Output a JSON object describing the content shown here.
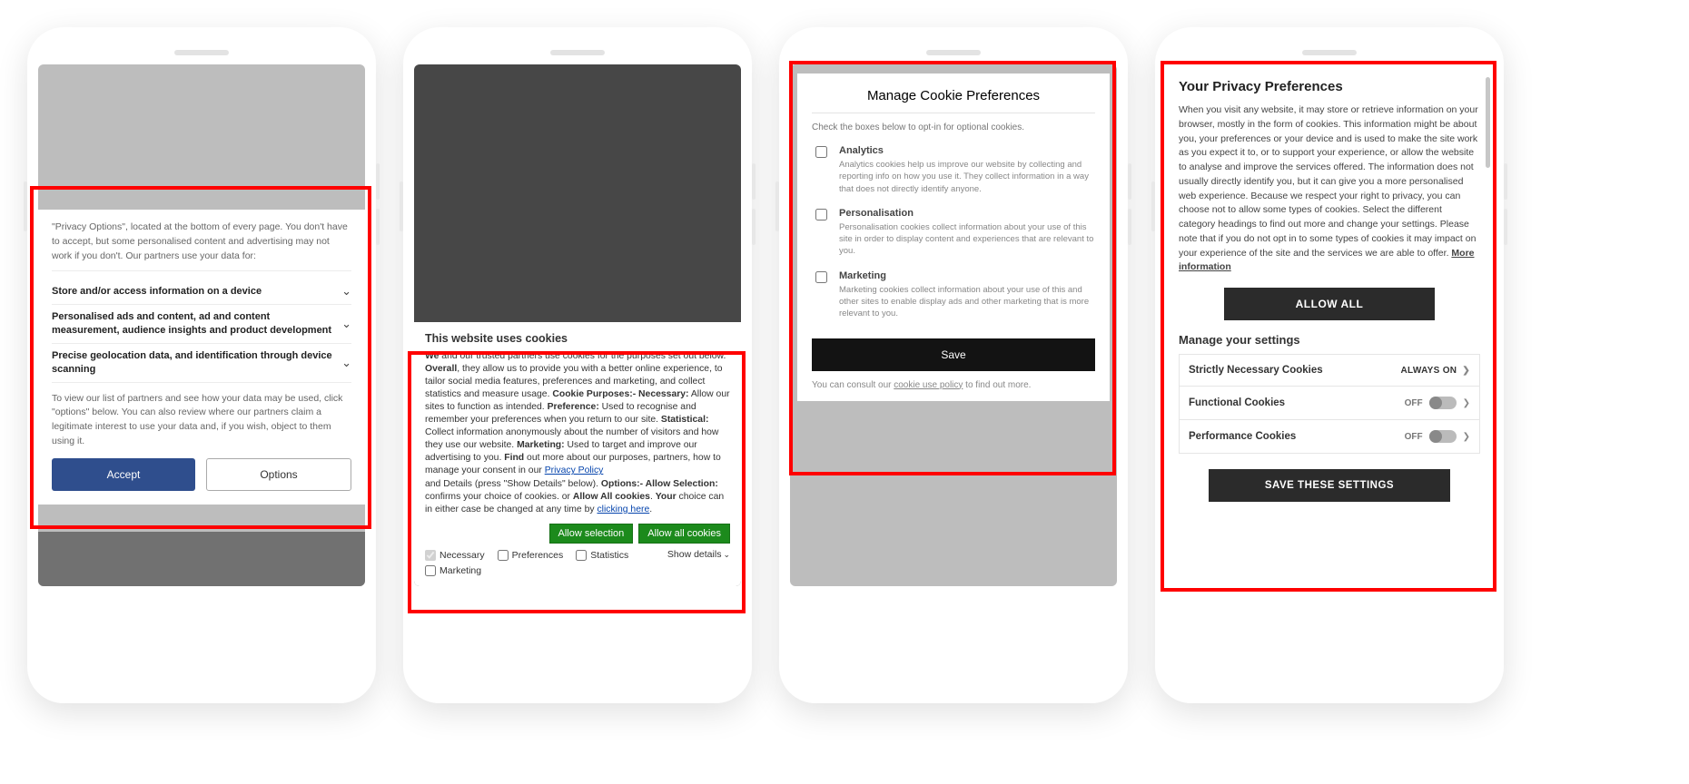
{
  "phone1": {
    "intro": "\"Privacy Options\", located at the bottom of every page. You don't have to accept, but some personalised content and advertising may not work if you don't. Our partners use your data for:",
    "rows": [
      "Store and/or access information on a device",
      "Personalised ads and content, ad and content measurement, audience insights and product development",
      "Precise geolocation data, and identification through device scanning"
    ],
    "outro": "To view our list of partners and see how your data may be used, click \"options\" below. You can also review where our partners claim a legitimate interest to use your data and, if you wish, object to them using it.",
    "accept": "Accept",
    "options": "Options"
  },
  "phone2": {
    "title": "This website uses cookies",
    "t": {
      "we": "We",
      "t1": " and our trusted partners use cookies for the purposes set out below. ",
      "overall": "Overall",
      "t2": ", they allow us to provide you with a better online experience, to tailor social media features, preferences and marketing, and collect statistics and measure usage. ",
      "cp": "Cookie Purposes:- Necessary:",
      "t3": " Allow our sites to function as intended. ",
      "pref": "Preference:",
      "t4": " Used to recognise and remember your preferences when you return to our site. ",
      "stat": "Statistical:",
      "t5": " Collect information anonymously about the number of visitors and how they use our website. ",
      "mkt": "Marketing:",
      "t6": " Used to target and improve our advertising to you. ",
      "find": "Find",
      "t7": " out more about our purposes, partners, how to manage your consent in our ",
      "pp": "Privacy Policy",
      "t8": " and Details (press \"Show Details\" below). ",
      "opt": "Options:- Allow Selection:",
      "t9": " confirms your choice of cookies. or ",
      "aac": "Allow All cookies",
      "t10": ". ",
      "your": "Your",
      "t11": " choice can in either case be changed at any time by ",
      "click": "clicking here",
      "t12": "."
    },
    "btn_sel": "Allow selection",
    "btn_all": "Allow all cookies",
    "chk": {
      "nec": "Necessary",
      "pref": "Preferences",
      "stat": "Statistics",
      "mkt": "Marketing"
    },
    "show": "Show details"
  },
  "phone3": {
    "title": "Manage Cookie Preferences",
    "sub": "Check the boxes below to opt-in for optional cookies.",
    "opts": [
      {
        "t": "Analytics",
        "d": "Analytics cookies help us improve our website by collecting and reporting info on how you use it. They collect information in a way that does not directly identify anyone."
      },
      {
        "t": "Personalisation",
        "d": "Personalisation cookies collect information about your use of this site in order to display content and experiences that are relevant to you."
      },
      {
        "t": "Marketing",
        "d": "Marketing cookies collect information about your use of this and other sites to enable display ads and other marketing that is more relevant to you."
      }
    ],
    "save": "Save",
    "pol_a": "You can consult our ",
    "pol_b": "cookie use policy",
    "pol_c": " to find out more."
  },
  "phone4": {
    "title": "Your Privacy Preferences",
    "body": "When you visit any website, it may store or retrieve information on your browser, mostly in the form of cookies. This information might be about you, your preferences or your device and is used to make the site work as you expect it to, or to support your experience, or allow the website to analyse and improve the services offered. The information does not usually directly identify you, but it can give you a more personalised web experience. Because we respect your right to privacy, you can choose not to allow some types of cookies. Select the different category headings to find out more and change your settings. Please note that if you do not opt in to some types of cookies it may impact on your experience of the site and the services we are able to offer.  ",
    "more": "More information",
    "allow": "ALLOW ALL",
    "manage": "Manage your settings",
    "rows": [
      {
        "l": "Strictly Necessary Cookies",
        "v": "ALWAYS ON"
      },
      {
        "l": "Functional Cookies",
        "v": "OFF"
      },
      {
        "l": "Performance Cookies",
        "v": "OFF"
      }
    ],
    "save": "SAVE THESE SETTINGS"
  }
}
